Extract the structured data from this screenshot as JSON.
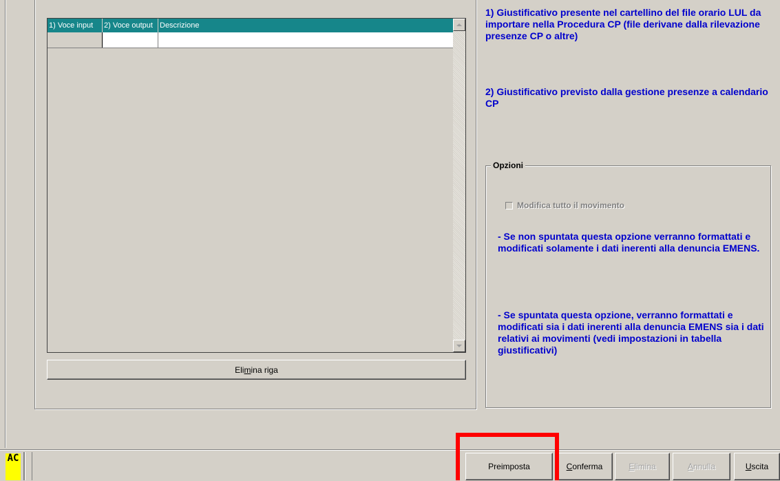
{
  "grid": {
    "columns": [
      "1) Voce input",
      "2) Voce output",
      "Descrizione"
    ],
    "rows": [
      [
        "",
        "",
        ""
      ]
    ]
  },
  "buttons": {
    "elimina_riga": {
      "pre": "Eli",
      "accel": "m",
      "post": "ina riga"
    },
    "preimposta": "Preimposta",
    "conferma": {
      "accel": "C",
      "post": "onferma"
    },
    "elimina": {
      "accel": "E",
      "post": "limina"
    },
    "annulla": {
      "accel": "A",
      "post": "nnulla"
    },
    "uscita": {
      "accel": "U",
      "post": "scita"
    }
  },
  "info": {
    "line1": "1) Giustificativo presente nel cartellino del file orario LUL da importare nella Procedura CP (file derivane dalla rilevazione presenze CP o altre)",
    "line2": "2) Giustificativo  previsto dalla gestione presenze a calendario CP"
  },
  "opzioni": {
    "title": "Opzioni",
    "checkbox_label": "Modifica tutto il movimento",
    "checkbox_checked": false,
    "text1": "- Se non spuntata questa opzione verranno formattati e modificati solamente i dati inerenti alla denuncia EMENS.",
    "text2": "- Se spuntata questa opzione, verranno formattati e modificati sia i dati inerenti alla denuncia EMENS sia i dati relativi ai movimenti (vedi impostazioni in tabella giustificativi)"
  },
  "logo": {
    "text": "AC"
  },
  "colors": {
    "header": "#16868a",
    "info_text": "#0000cc",
    "highlight": "#ff0000",
    "logo": "#ffff00"
  }
}
